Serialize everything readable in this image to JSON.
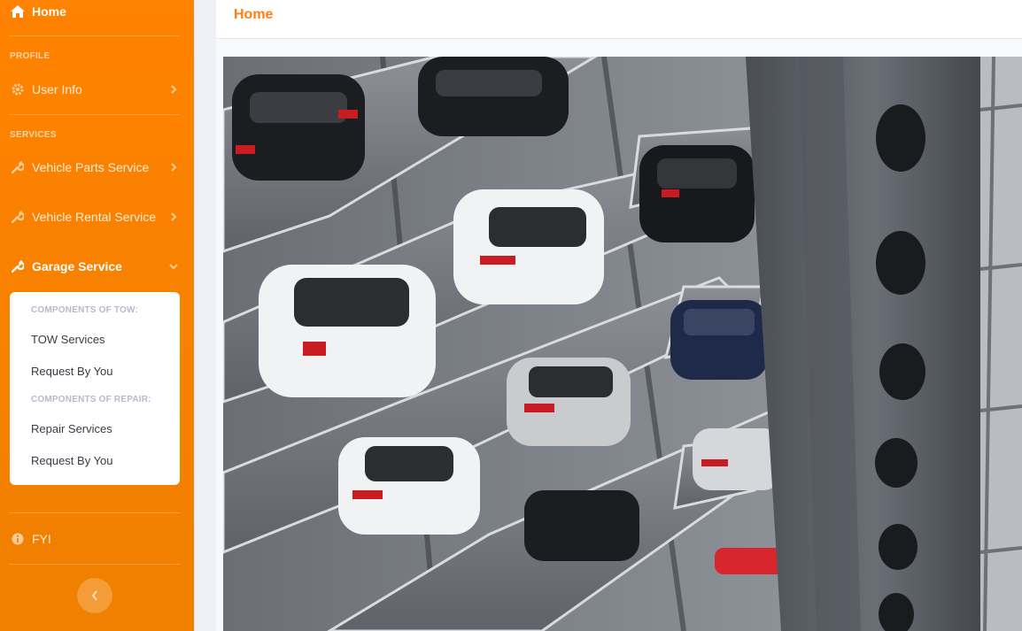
{
  "sidebar": {
    "home_label": "Home",
    "profile_heading": "PROFILE",
    "user_info_label": "User Info",
    "services_heading": "SERVICES",
    "vehicle_parts_label": "Vehicle Parts Service",
    "vehicle_rental_label": "Vehicle Rental Service",
    "garage_label": "Garage Service",
    "fyi_label": "FYI",
    "accent": "#ff8200"
  },
  "garage_menu": {
    "tow_heading": "COMPONENTS OF TOW:",
    "tow_services": "TOW Services",
    "tow_request": "Request By You",
    "repair_heading": "COMPONENTS OF REPAIR:",
    "repair_services": "Repair Services",
    "repair_request": "Request By You"
  },
  "topbar": {
    "title": "Home",
    "title_color": "#ff7f11"
  },
  "icons": {
    "home": "home-icon",
    "user_info": "gear-icon",
    "services": "wrench-icon",
    "fyi": "info-icon",
    "toggle": "chevron-left-icon"
  }
}
